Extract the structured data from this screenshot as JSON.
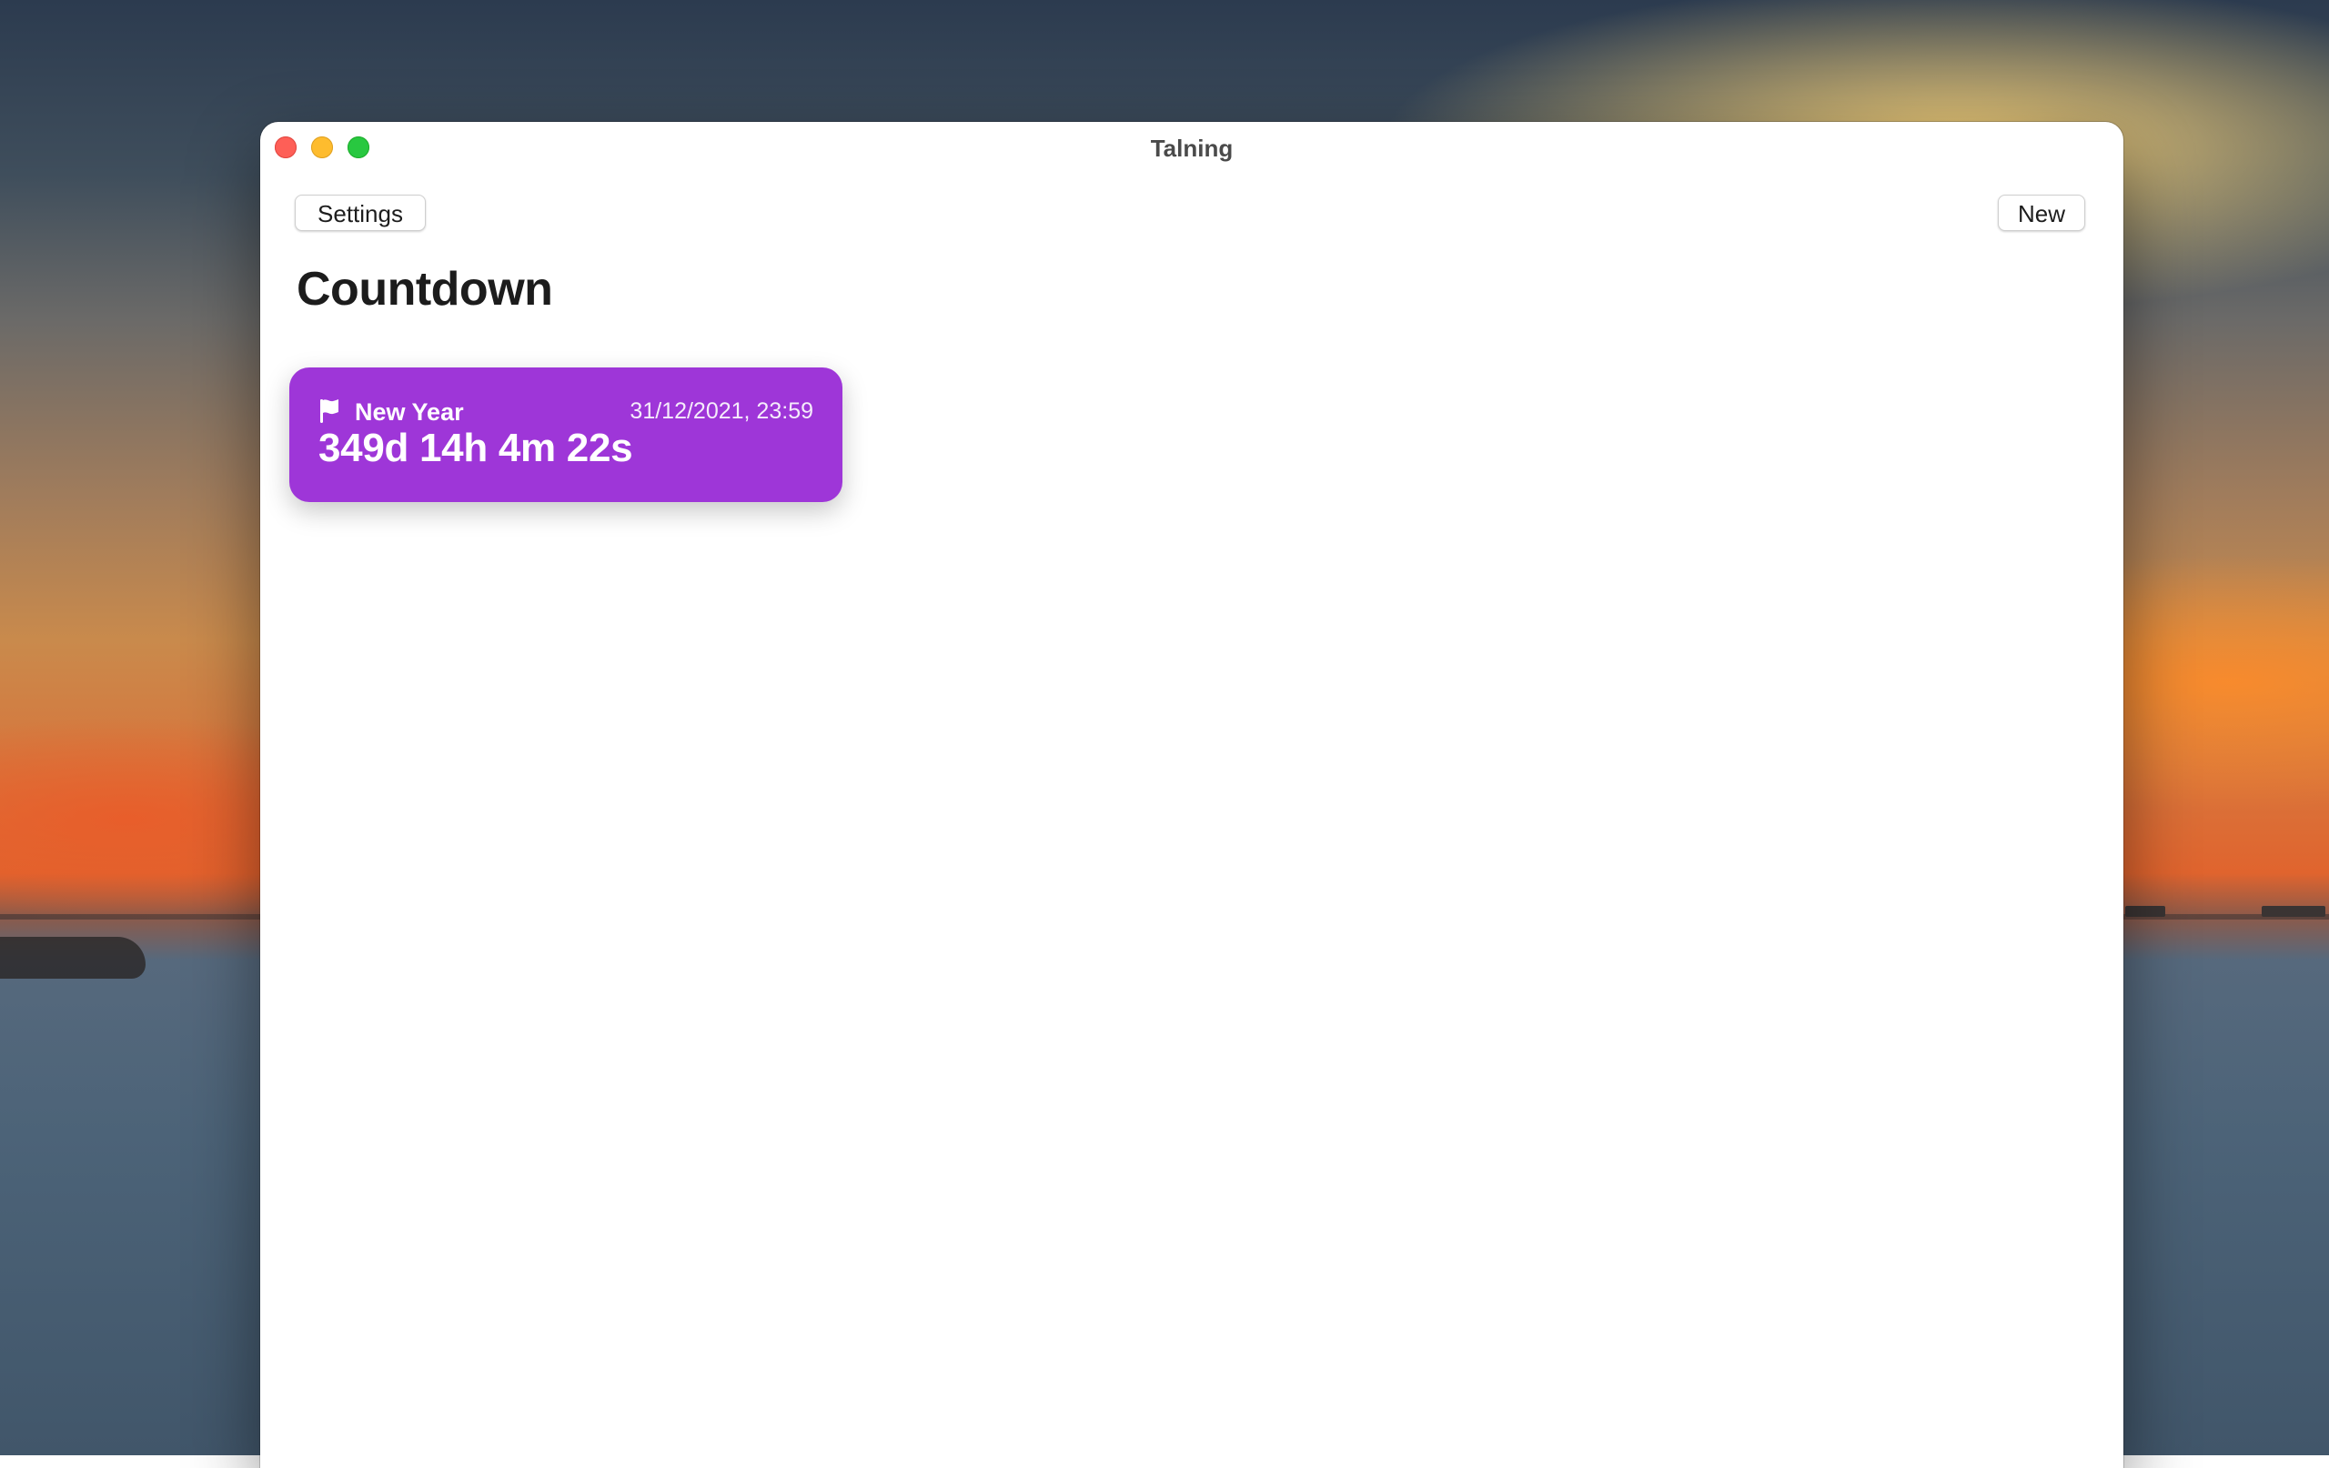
{
  "window": {
    "title": "Talning"
  },
  "toolbar": {
    "settings_label": "Settings",
    "new_label": "New"
  },
  "main": {
    "title": "Countdown",
    "countdowns": [
      {
        "name": "New Year",
        "date": "31/12/2021, 23:59",
        "remaining": "349d 14h 4m 22s",
        "icon": "flag-icon",
        "color": "#9e36d8"
      }
    ]
  }
}
